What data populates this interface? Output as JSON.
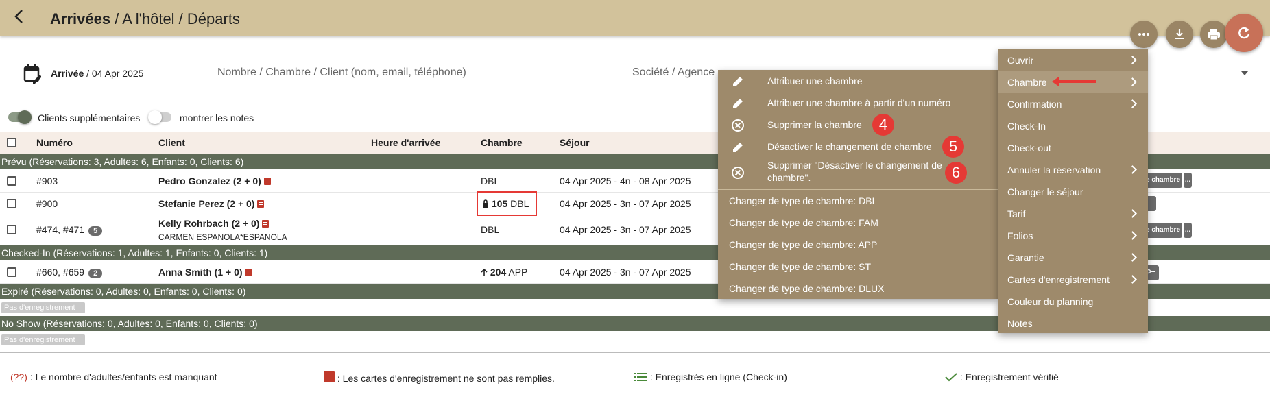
{
  "header": {
    "title_bold": "Arrivées",
    "title_rest": " / A l'hôtel / Départs"
  },
  "filters": {
    "date_label": "Arrivée",
    "date_value": " / 04 Apr 2025",
    "search_placeholder": "Nombre / Chambre / Client (nom, email, téléphone)",
    "company_placeholder": "Société / Agence"
  },
  "toggles": {
    "extra_clients": "Clients supplémentaires",
    "show_notes": "montrer les notes"
  },
  "columns": {
    "numero": "Numéro",
    "client": "Client",
    "heure": "Heure d'arrivée",
    "chambre": "Chambre",
    "sejour": "Séjour"
  },
  "groups": {
    "prevu": "Prévu (Réservations: 3, Adultes: 6, Enfants: 0, Clients: 6)",
    "checked_in": "Checked-In (Réservations: 1, Adultes: 1, Enfants: 0, Clients: 1)",
    "expire": "Expiré (Réservations: 0, Adultes: 0, Enfants: 0, Clients: 0)",
    "no_show": "No Show (Réservations: 0, Adultes: 0, Enfants: 0, Clients: 0)",
    "no_registration": "Pas d'enregistrement"
  },
  "rows": [
    {
      "numero": "#903",
      "client": "Pedro Gonzalez (2 + 0)",
      "chambre_num": "",
      "chambre": "DBL",
      "sejour": "04 Apr 2025 - 4n - 08 Apr 2025"
    },
    {
      "numero": "#900",
      "client": "Stefanie Perez (2 + 0)",
      "chambre_num": "105",
      "chambre": "DBL",
      "sejour": "04 Apr 2025 - 3n - 07 Apr 2025"
    },
    {
      "numero": "#474, #471",
      "count": "5",
      "client": "Kelly Rohrbach (2 + 0)",
      "company": "CARMEN ESPANOLA*ESPANOLA",
      "chambre": "DBL",
      "sejour": "04 Apr 2025 - 3n - 07 Apr 2025"
    },
    {
      "numero": "#660, #659",
      "count": "2",
      "client": "Anna Smith (1 + 0)",
      "chambre_num": "204",
      "chambre": "APP",
      "sejour": "04 Apr 2025 - 3n - 07 Apr 2025"
    }
  ],
  "row_buttons": {
    "chambre": "e chambre",
    "more": "..."
  },
  "submenu": {
    "items": [
      "Attribuer une chambre",
      "Attribuer une chambre à partir d'un numéro",
      "Supprimer la chambre",
      "Désactiver le changement de chambre",
      "Supprimer \"Désactiver le changement de",
      "chambre\".",
      "Changer de type de chambre: DBL",
      "Changer de type de chambre: FAM",
      "Changer de type de chambre: APP",
      "Changer de type de chambre: ST",
      "Changer de type de chambre: DLUX"
    ],
    "badges": [
      "4",
      "5",
      "6"
    ]
  },
  "mainmenu": {
    "items": [
      "Ouvrir",
      "Chambre",
      "Confirmation",
      "Check-In",
      "Check-out",
      "Annuler la réservation",
      "Changer le séjour",
      "Tarif",
      "Folios",
      "Garantie",
      "Cartes d'enregistrement",
      "Couleur du planning",
      "Notes"
    ]
  },
  "legend": {
    "missing": "(??)",
    "missing_text": " : Le nombre d'adultes/enfants est manquant",
    "cards_text": " : Les cartes d'enregistrement ne sont pas remplies.",
    "online_text": " : Enregistrés en ligne (Check-in)",
    "verified_text": " : Enregistrement vérifié"
  },
  "colors": {
    "topbar": "#d2c29b",
    "menu_bg": "#9e8a6b",
    "group_bg": "#5f6b57",
    "accent_red": "#e53935",
    "refresh": "#c87158"
  }
}
